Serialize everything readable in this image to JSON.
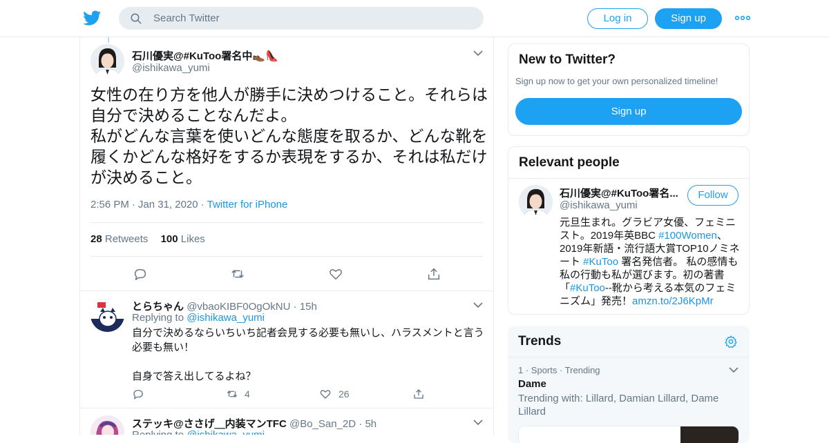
{
  "header": {
    "search_placeholder": "Search Twitter",
    "login_label": "Log in",
    "signup_label": "Sign up",
    "brand_color": "#1da1f2"
  },
  "main_tweet": {
    "name": "石川優実@#KuToo署名中👞👠",
    "handle": "@ishikawa_yumi",
    "text": "女性の在り方を他人が勝手に決めつけること。それらは自分で決めることなんだよ。\n私がどんな言葉を使いどんな態度を取るか、どんな靴を履くかどんな格好をするか表現をするか、それは私だけが決めること。",
    "time": "2:56 PM",
    "date": "Jan 31, 2020",
    "source": "Twitter for iPhone",
    "retweets_count": "28",
    "retweets_label": "Retweets",
    "likes_count": "100",
    "likes_label": "Likes"
  },
  "replies": [
    {
      "name": "とらちゃん",
      "handle": "@vbaoKIBF0OgOkNU",
      "age": "15h",
      "replying_prefix": "Replying to",
      "replying_to": "@ishikawa_yumi",
      "text": "自分で決めるならいちいち記者会見する必要も無いし、ハラスメントと言う必要も無い！\n\n自身で答え出してるよね？",
      "retweets": "4",
      "likes": "26"
    },
    {
      "name": "ステッキ@ささげ＿内装マンTFC",
      "handle": "@Bo_San_2D",
      "age": "5h",
      "replying_prefix": "Replying to",
      "replying_to": "@ishikawa_yumi"
    }
  ],
  "sidebar": {
    "new_to_twitter": {
      "title": "New to Twitter?",
      "subtitle": "Sign up now to get your own personalized timeline!",
      "button": "Sign up"
    },
    "relevant_people": {
      "title": "Relevant people",
      "name": "石川優実@#KuToo署名...",
      "handle": "@ishikawa_yumi",
      "follow_label": "Follow",
      "bio_1": "元旦生まれ。グラビア女優、フェミニスト。2019年英BBC ",
      "bio_tag_1": "#100Women",
      "bio_2": "、2019年新語・流行語大賞TOP10ノミネート ",
      "bio_tag_2": "#KuToo",
      "bio_3": " 署名発信者。 私の感情も私の行動も私が選びます。初の著書「",
      "bio_tag_3": "#KuToo",
      "bio_4": "--靴から考える本気のフェミニズム」発売！",
      "bio_link": "amzn.to/2J6KpMr"
    },
    "trends": {
      "title": "Trends",
      "items": [
        {
          "rank": "1",
          "category": "Sports",
          "status": "Trending",
          "name": "Dame",
          "with": "Trending with: Lillard, Damian Lillard, Dame Lillard"
        }
      ]
    }
  }
}
